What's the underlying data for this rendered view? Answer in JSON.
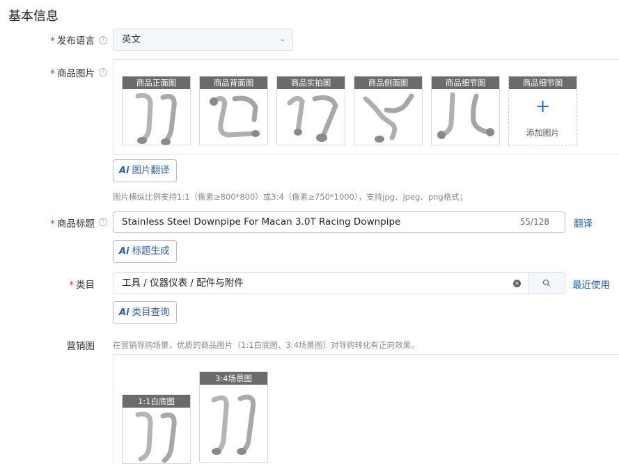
{
  "section": {
    "title": "基本信息"
  },
  "language": {
    "label": "发布语言",
    "value": "英文"
  },
  "product_images": {
    "label": "商品图片",
    "slots": [
      {
        "caption": "商品正面图"
      },
      {
        "caption": "商品背面图"
      },
      {
        "caption": "商品实拍图"
      },
      {
        "caption": "商品侧面图"
      },
      {
        "caption": "商品细节图"
      }
    ],
    "add_slot": {
      "caption": "商品细节图",
      "label": "添加图片"
    },
    "ai_button": "图片翻译",
    "hint": "图片横纵比例支持1:1（像素≥800*800）或3:4（像素≥750*1000），支持jpg、jpeg、png格式；"
  },
  "title_field": {
    "label": "商品标题",
    "value": "Stainless Steel Downpipe For Macan 3.0T Racing Downpipe",
    "count": "55/128",
    "translate_link": "翻译",
    "ai_button": "标题生成"
  },
  "category": {
    "label": "类目",
    "value": "工具 / 仪器仪表 / 配件与附件",
    "recent_link": "最近使用",
    "ai_button": "类目查询"
  },
  "marketing": {
    "label": "营销图",
    "hint": "在营销导购场景，优质的商品图片（1:1白底图、3:4场景图）对导购转化有正向效果。",
    "images": [
      {
        "caption": "1:1白底图"
      },
      {
        "caption": "3:4场景图"
      }
    ]
  },
  "ai_prefix": "Ai"
}
